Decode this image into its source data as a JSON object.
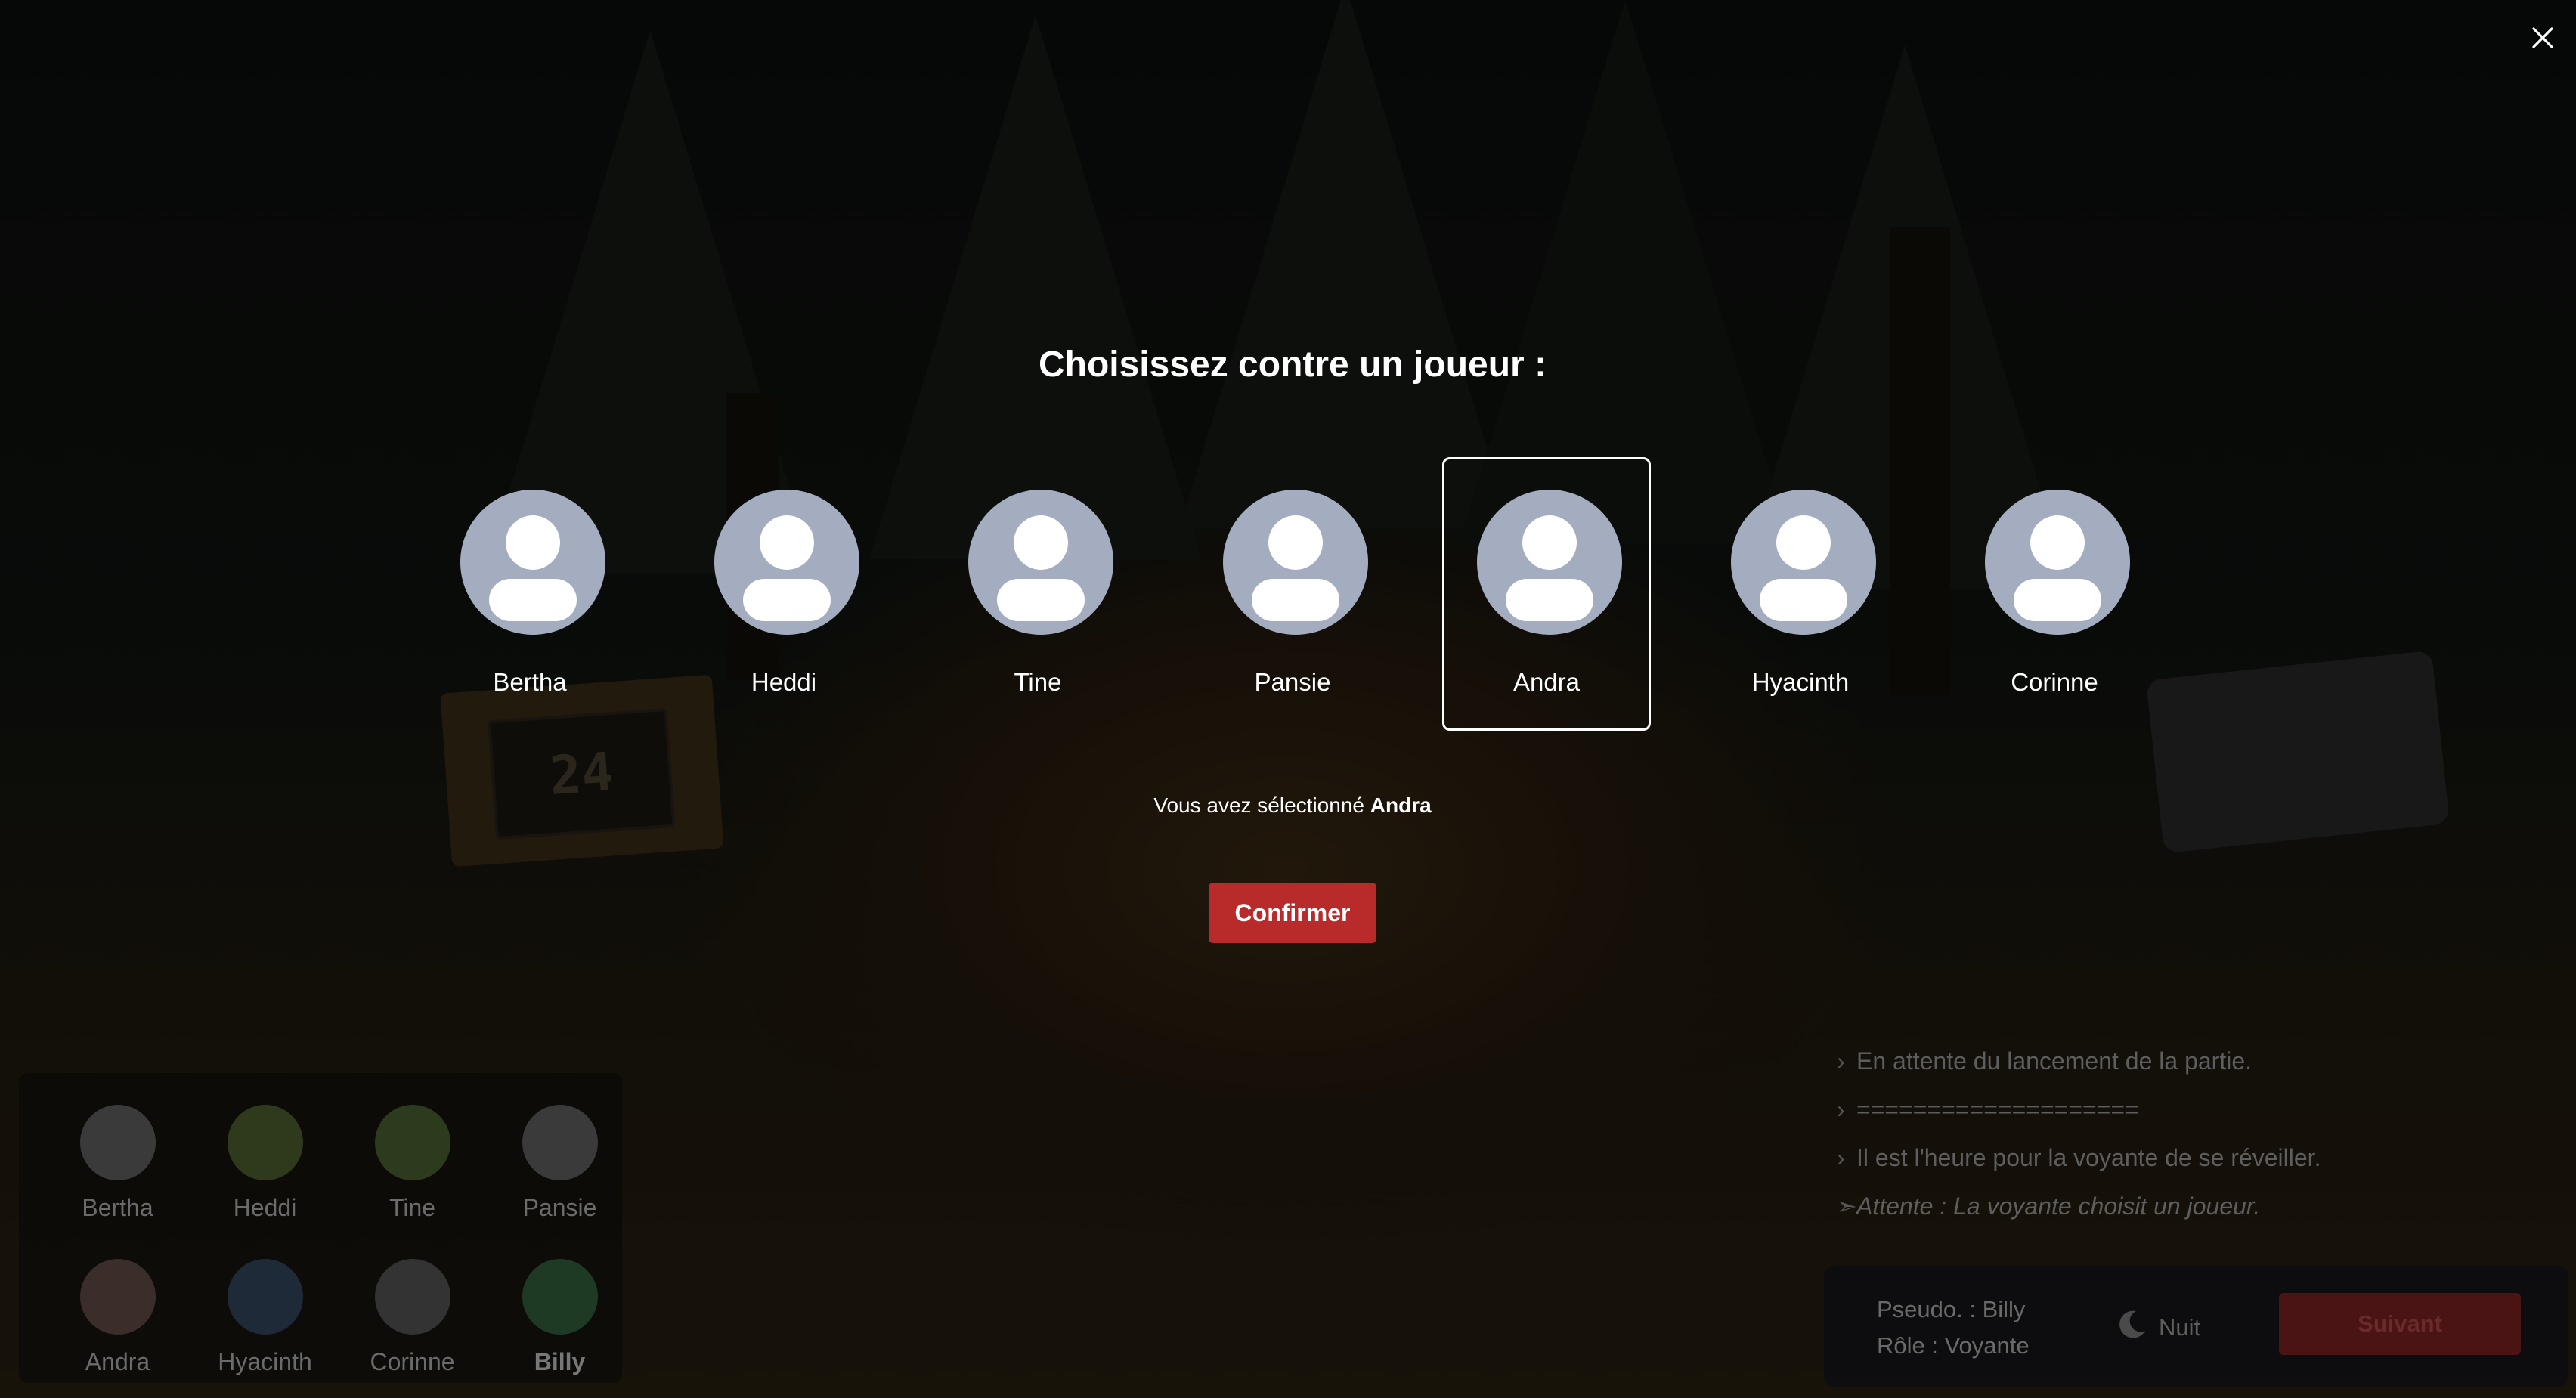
{
  "modal": {
    "title": "Choisissez contre un joueur :",
    "players": [
      {
        "name": "Bertha",
        "selected": false
      },
      {
        "name": "Heddi",
        "selected": false
      },
      {
        "name": "Tine",
        "selected": false
      },
      {
        "name": "Pansie",
        "selected": false
      },
      {
        "name": "Andra",
        "selected": true
      },
      {
        "name": "Hyacinth",
        "selected": false
      },
      {
        "name": "Corinne",
        "selected": false
      }
    ],
    "selection_prefix": "Vous avez sélectionné",
    "selected_name": "Andra",
    "confirm_label": "Confirmer",
    "close_icon": "close-icon",
    "confirm_color": "#b92a2a"
  },
  "background": {
    "sign_text": "24",
    "players_panel": [
      {
        "name": "Bertha",
        "color": "#3a3a3a"
      },
      {
        "name": "Heddi",
        "color": "#2f3a1c"
      },
      {
        "name": "Tine",
        "color": "#2c3a1e"
      },
      {
        "name": "Pansie",
        "color": "#3a3a3a"
      },
      {
        "name": "Andra",
        "color": "#3a2d2a"
      },
      {
        "name": "Hyacinth",
        "color": "#1e2a38"
      },
      {
        "name": "Corinne",
        "color": "#333333"
      },
      {
        "name": "Billy",
        "color": "#1e3a24",
        "bold": true
      }
    ],
    "log": [
      {
        "text": "En attente du lancement de la partie.",
        "italic": false
      },
      {
        "text": "====================",
        "italic": false
      },
      {
        "text": "Il est l'heure pour la voyante de se réveiller.",
        "italic": false
      },
      {
        "text": "Attente : La voyante choisit un joueur.",
        "italic": true
      }
    ],
    "status": {
      "pseudo": "Pseudo. : Billy",
      "role": "Rôle : Voyante",
      "phase_label": "Nuit",
      "phase_icon": "moon-icon",
      "next_label": "Suivant"
    }
  }
}
